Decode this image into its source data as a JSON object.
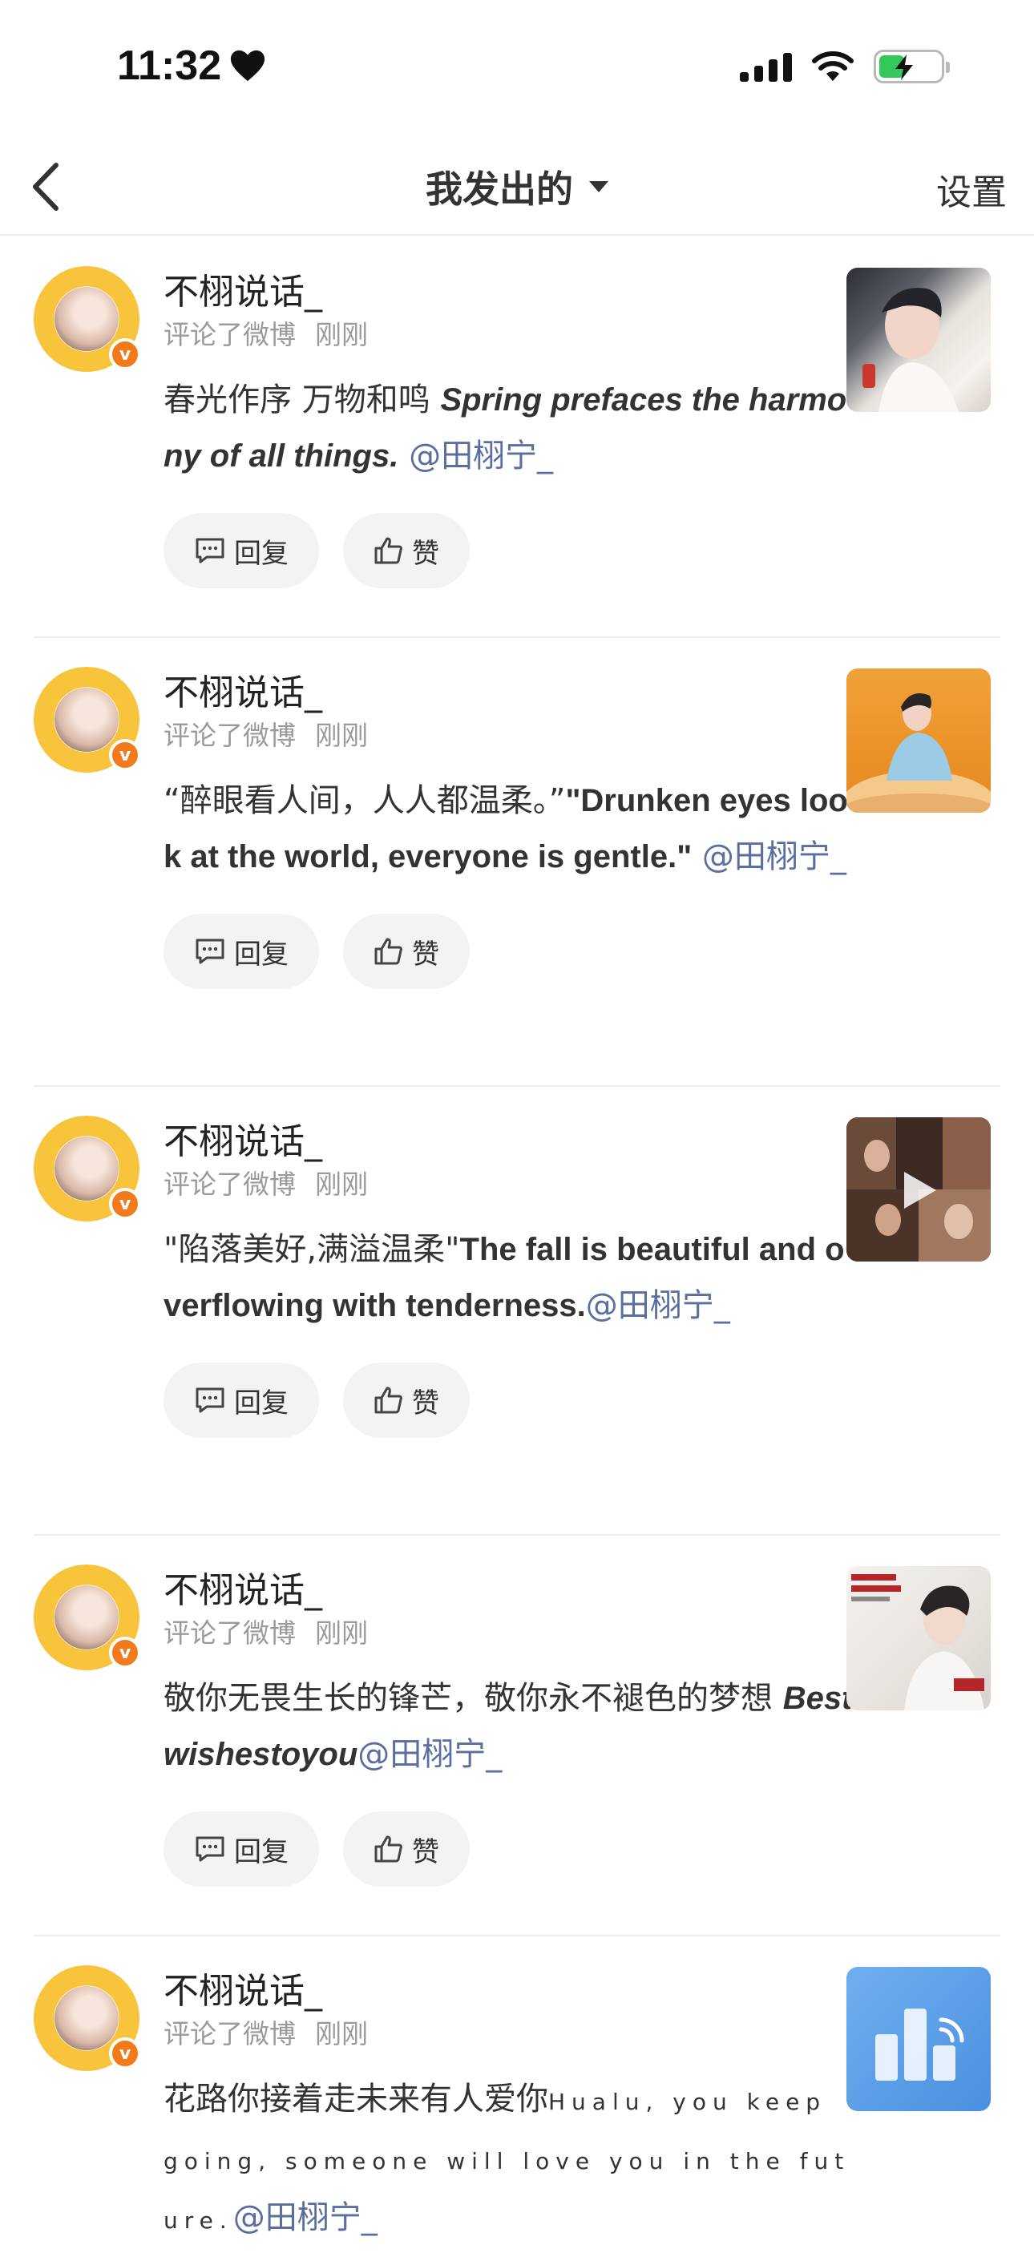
{
  "status_bar": {
    "time": "11:32"
  },
  "nav": {
    "title": "我发出的",
    "settings": "设置"
  },
  "posts": [
    {
      "name": "不栩说话_",
      "action": "评论了微博",
      "time": "刚刚",
      "text_zh": "春光作序 万物和鸣",
      "text_en": "Spring prefaces the harmony of all things.",
      "mention": "@田栩宁_",
      "reply": "回复",
      "like": "赞"
    },
    {
      "name": "不栩说话_",
      "action": "评论了微博",
      "time": "刚刚",
      "text_zh": "“醉眼看人间，人人都温柔。”",
      "text_en": "\"Drunken eyes look at the world, everyone is gentle.\"",
      "mention": "@田栩宁_",
      "reply": "回复",
      "like": "赞"
    },
    {
      "name": "不栩说话_",
      "action": "评论了微博",
      "time": "刚刚",
      "text_zh": "\"陷落美好,满溢温柔\"",
      "text_en": "The fall is beautiful and overflowing with tenderness.",
      "mention": "@田栩宁_",
      "reply": "回复",
      "like": "赞"
    },
    {
      "name": "不栩说话_",
      "action": "评论了微博",
      "time": "刚刚",
      "text_zh": "敬你无畏生长的锋芒，敬你永不褪色的梦想 ",
      "text_en": "Bestwishestoyou",
      "mention": "@田栩宁_",
      "reply": "回复",
      "like": "赞"
    },
    {
      "name": "不栩说话_",
      "action": "评论了微博",
      "time": "刚刚",
      "text_zh": "花路你接着走未来有人爱你",
      "text_en": "Hualu, you keep going, someone will love you in the future.",
      "mention": "@田栩宁_",
      "reply": "回复",
      "like": "赞"
    }
  ],
  "icons": {
    "back": "chevron-left-icon",
    "dropdown": "caret-down-icon",
    "reply": "comment-icon",
    "like": "thumbs-up-icon",
    "verified": "verified-badge-icon"
  },
  "colors": {
    "mention": "#5a6fa0",
    "badge": "#f27a1a",
    "pill_bg": "#f3f3f3"
  }
}
